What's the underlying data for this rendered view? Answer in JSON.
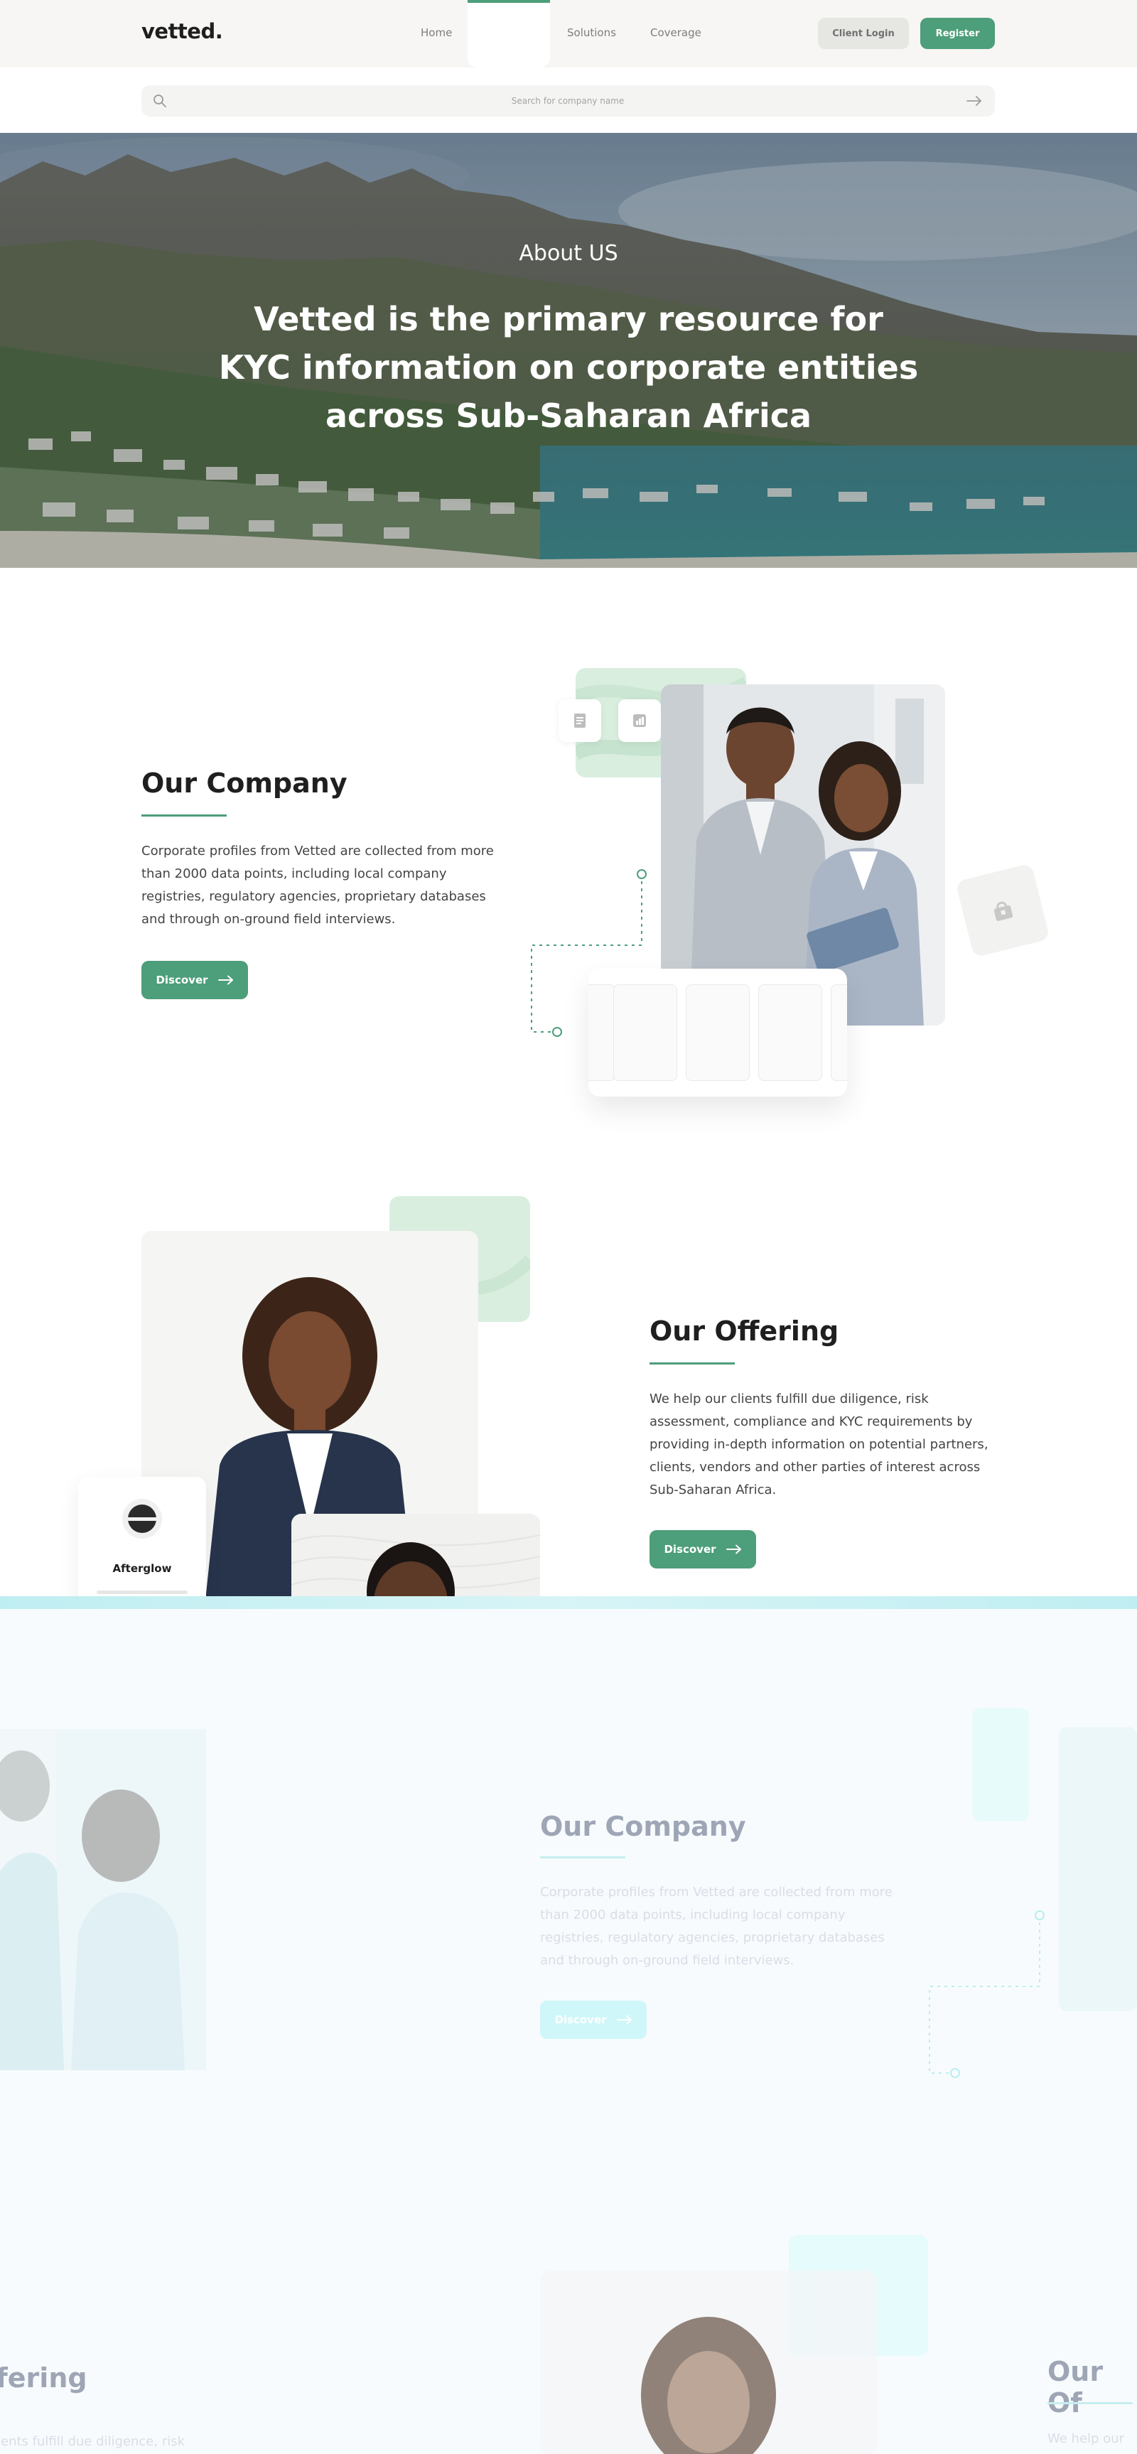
{
  "nav": {
    "logo": "vetted.",
    "links": [
      "Home",
      "Solutions",
      "Coverage"
    ],
    "client_login": "Client Login",
    "register": "Register"
  },
  "search": {
    "placeholder": "Search for company name"
  },
  "hero": {
    "kicker": "About US",
    "headline": "Vetted is the primary resource for KYC information on corporate entities across Sub-Saharan Africa"
  },
  "company": {
    "title": "Our Company",
    "body": "Corporate profiles from Vetted are collected from more than 2000 data points, including local company registries, regulatory agencies, proprietary databases and through on-ground field interviews.",
    "button": "Discover"
  },
  "offering": {
    "title": "Our Offering",
    "body": "We help our clients fulfill due diligence, risk assessment, compliance and KYC requirements by providing in-depth information on potential partners, clients, vendors and other parties of interest across Sub-Saharan Africa.",
    "button": "Discover",
    "badge_label": "Afterglow"
  },
  "faded": {
    "company_title": "Our Company",
    "company_body": "Corporate profiles from Vetted are collected from more than 2000 data points, including local company registries, regulatory agencies, proprietary databases and through on-ground field interviews.",
    "company_button": "Discover",
    "offering_title_left": "ffering",
    "offering_body_left": "ients fulfill due diligence, risk",
    "offering_title_right": "Our Of",
    "offering_body_right": "We help our"
  },
  "colors": {
    "accent": "#4d9e7a",
    "nav_bg": "#f7f6f4",
    "mint": "#d6ecde"
  }
}
